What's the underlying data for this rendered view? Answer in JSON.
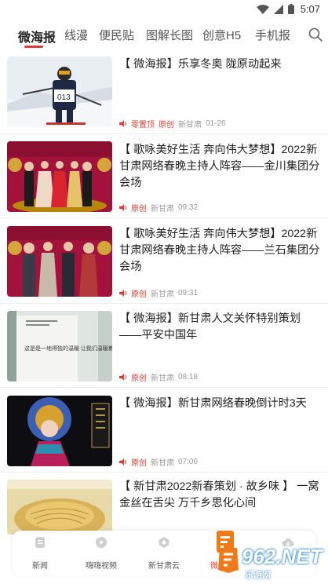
{
  "status_bar": {
    "time": "5:07"
  },
  "tabs": [
    {
      "label": "微海报",
      "active": true
    },
    {
      "label": "线漫"
    },
    {
      "label": "便民贴"
    },
    {
      "label": "图解长图"
    },
    {
      "label": "创意H5"
    },
    {
      "label": "手机报"
    }
  ],
  "articles": [
    {
      "title": "【 微海报】乐享冬奥  陇原动起来",
      "tags": [
        "零置顶",
        "原创"
      ],
      "source": "新甘肃",
      "time": "01-26",
      "thumb_text": "013"
    },
    {
      "title": "【 歌咏美好生活  奔向伟大梦想】2022新甘肃网络春晚主持人阵容——金川集团分会场",
      "tags": [
        "原创"
      ],
      "source": "新甘肃",
      "time": "09:32"
    },
    {
      "title": "【 歌咏美好生活  奔向伟大梦想】2022新甘肃网络春晚主持人阵容——兰石集团分会场",
      "tags": [
        "原创"
      ],
      "source": "新甘肃",
      "time": "09:31"
    },
    {
      "title": "【 微海报】新甘肃人文关怀特别策划——平安中国年",
      "tags": [
        "原创"
      ],
      "source": "新甘肃",
      "time": "08:18",
      "thumb_text": "这是是一地得独的温暖  让我们温暖着你"
    },
    {
      "title": "【 微海报】新甘肃网络春晚倒计时3天",
      "tags": [
        "原创"
      ],
      "source": "新甘肃",
      "time": "07:06"
    },
    {
      "title": "【 新甘肃2022新春策划 · 故乡味 】 一窝金丝在舌尖  万千乡思化心间",
      "tags": [],
      "source": "",
      "time": ""
    }
  ],
  "bottom_nav": [
    {
      "label": "新闻",
      "icon": "news-icon"
    },
    {
      "label": "嗨嗨视频",
      "icon": "video-icon"
    },
    {
      "label": "新甘肃云",
      "icon": "cloud-icon"
    },
    {
      "label": "微",
      "icon": "micro-icon",
      "active": true
    },
    {
      "label": "",
      "icon": "cloud-down-icon"
    }
  ],
  "watermark": {
    "main": "962.NET",
    "sub": "乐游网"
  },
  "colors": {
    "accent": "#e03a2f",
    "meta_gray": "#999999",
    "watermark_blue": "#1b7fd0"
  }
}
